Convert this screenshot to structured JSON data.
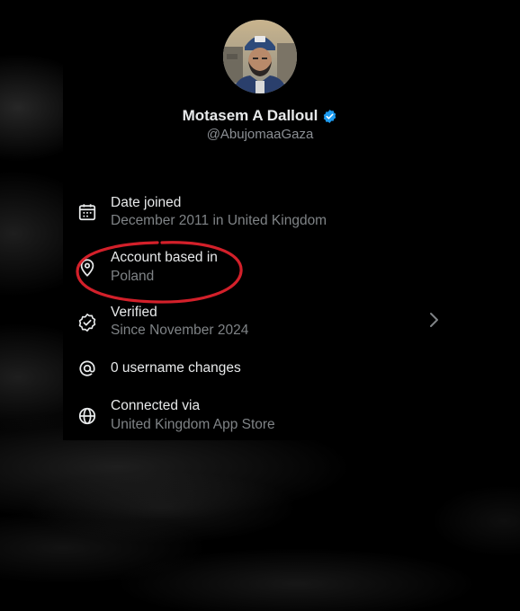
{
  "profile": {
    "name": "Motasem A Dalloul",
    "handle": "@AbujomaaGaza",
    "verified_badge_color": "#1d9bf0"
  },
  "details": {
    "date_joined": {
      "icon": "calendar-icon",
      "title": "Date joined",
      "subtitle": "December 2011 in United Kingdom"
    },
    "account_based": {
      "icon": "location-pin-icon",
      "title": "Account based in",
      "subtitle": "Poland"
    },
    "verified": {
      "icon": "verified-check-icon",
      "title": "Verified",
      "subtitle": "Since November 2024",
      "chevron_icon": "chevron-right-icon"
    },
    "username_changes": {
      "icon": "at-sign-icon",
      "title": "0 username changes"
    },
    "connected_via": {
      "icon": "globe-icon",
      "title": "Connected via",
      "subtitle": "United Kingdom App Store"
    }
  },
  "annotation": {
    "shape": "ellipse",
    "color": "#d3202a"
  },
  "colors": {
    "background": "#000000",
    "primary_text": "#e7e9ea",
    "secondary_text": "#7f8386"
  }
}
